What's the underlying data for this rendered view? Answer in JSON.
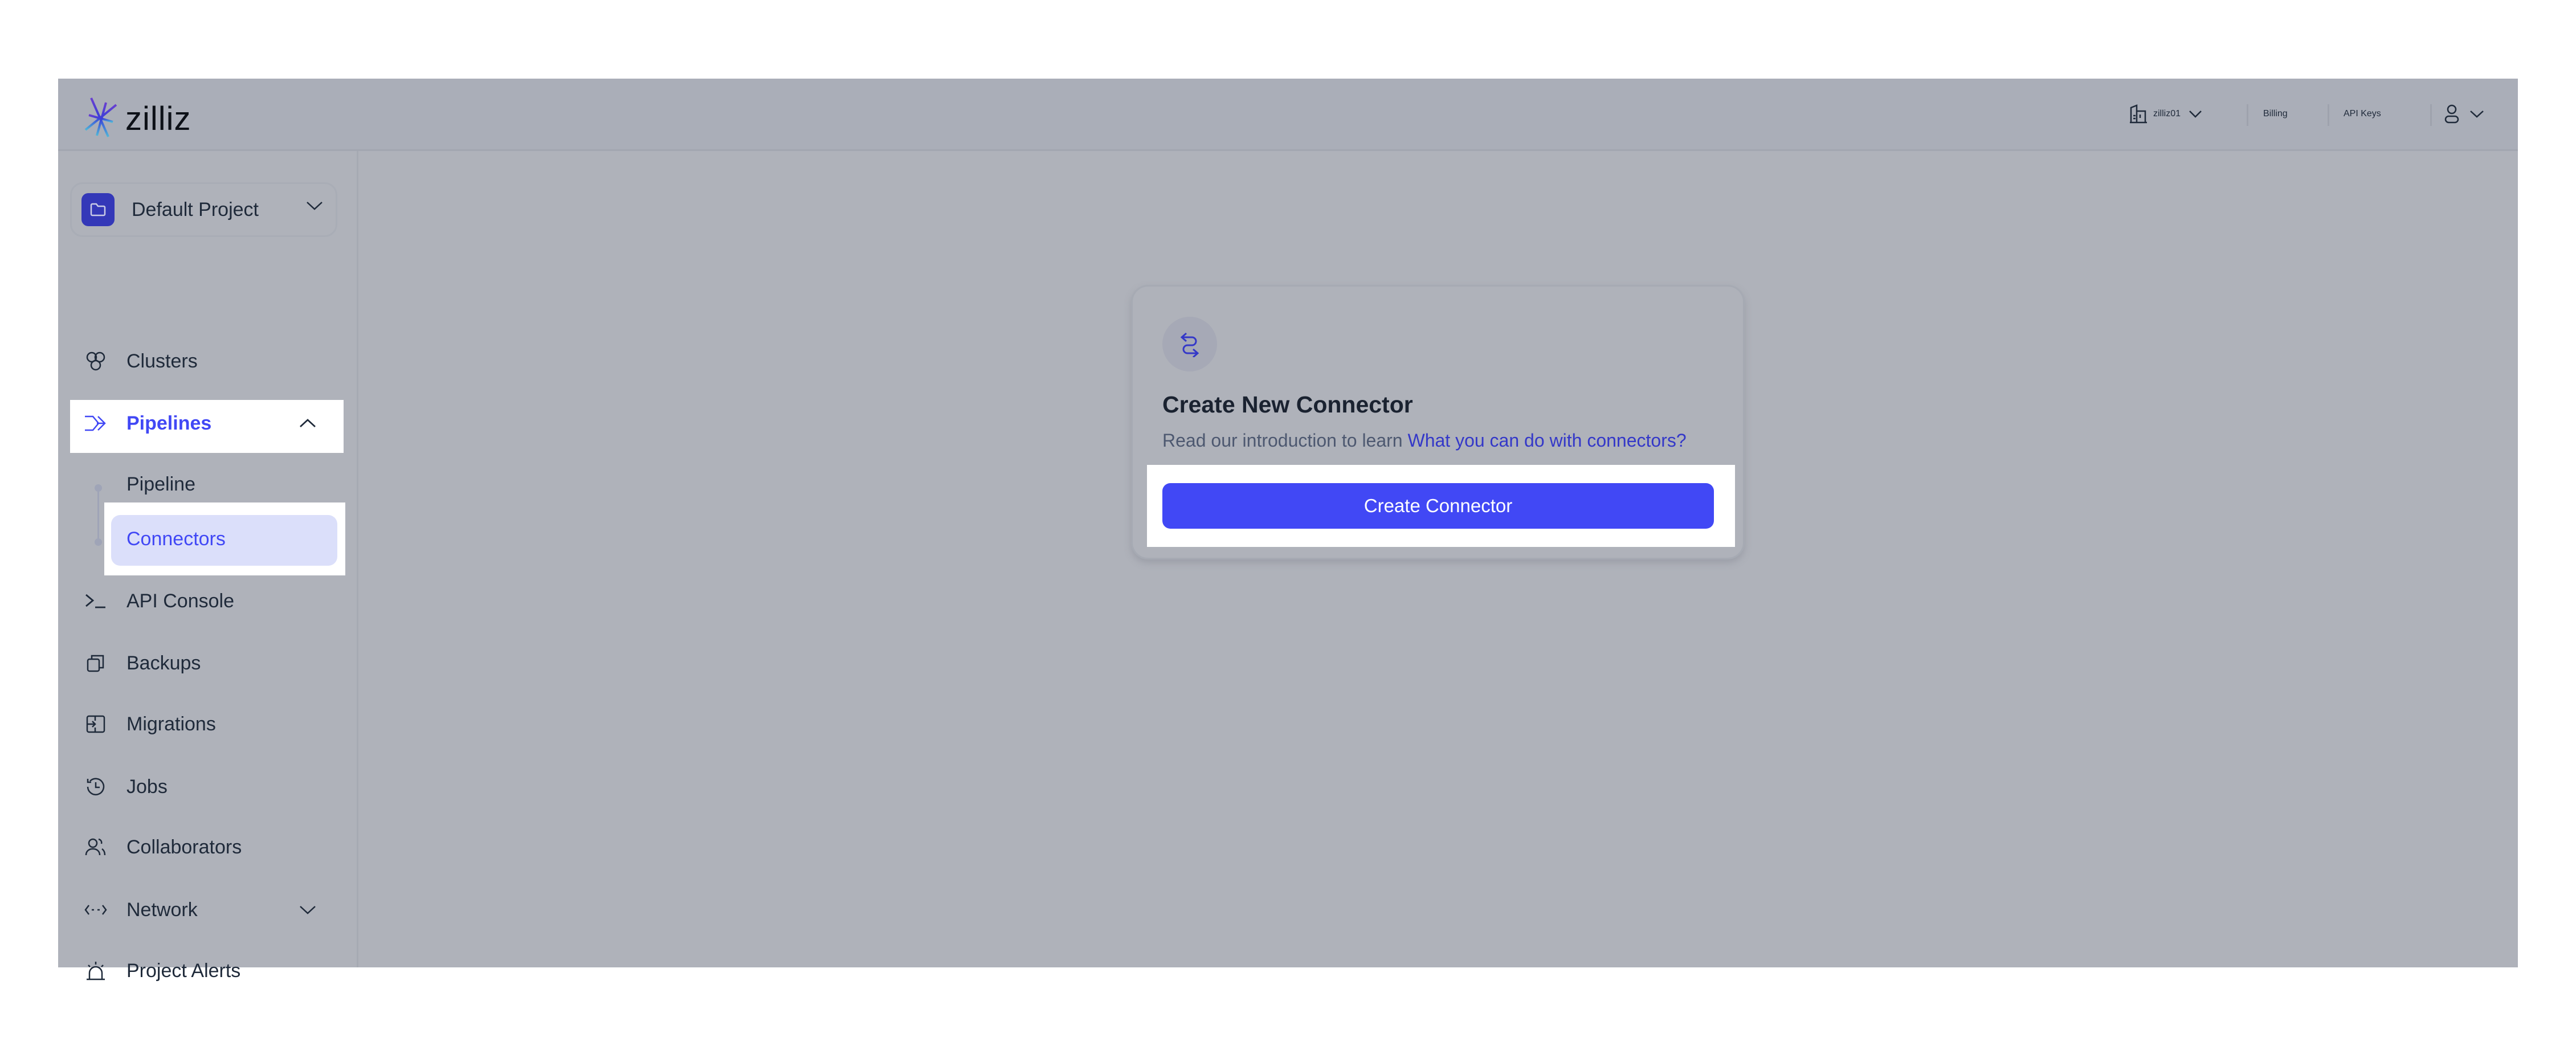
{
  "brand": {
    "name": "zilliz",
    "accent": "#4148f5",
    "logo_icon": "zilliz-starburst-logo"
  },
  "header": {
    "org": {
      "icon": "building-icon",
      "label": "zilliz01",
      "chevron": "chevron-down-icon"
    },
    "billing_label": "Billing",
    "api_keys_label": "API Keys",
    "user": {
      "icon": "user-icon",
      "chevron": "chevron-down-icon"
    }
  },
  "sidebar": {
    "project": {
      "icon": "folder-icon",
      "label": "Default Project",
      "chevron": "chevron-down-icon"
    },
    "items": [
      {
        "id": "clusters",
        "label": "Clusters",
        "icon": "clusters-icon"
      },
      {
        "id": "pipelines",
        "label": "Pipelines",
        "icon": "pipelines-icon",
        "expanded": true,
        "active": true,
        "children": [
          {
            "id": "pipeline",
            "label": "Pipeline"
          },
          {
            "id": "connectors",
            "label": "Connectors",
            "selected": true
          }
        ]
      },
      {
        "id": "api-console",
        "label": "API Console",
        "icon": "terminal-icon"
      },
      {
        "id": "backups",
        "label": "Backups",
        "icon": "backups-icon"
      },
      {
        "id": "migrations",
        "label": "Migrations",
        "icon": "migrations-icon"
      },
      {
        "id": "jobs",
        "label": "Jobs",
        "icon": "history-icon"
      },
      {
        "id": "collaborators",
        "label": "Collaborators",
        "icon": "users-icon"
      },
      {
        "id": "network",
        "label": "Network",
        "icon": "network-icon",
        "expanded": false
      },
      {
        "id": "project-alerts",
        "label": "Project Alerts",
        "icon": "siren-icon"
      }
    ]
  },
  "main": {
    "card": {
      "icon": "connector-arrows-icon",
      "title": "Create New Connector",
      "description_prefix": "Read our introduction to learn",
      "description_link": "What you can do with connectors?",
      "button_label": "Create Connector"
    }
  }
}
